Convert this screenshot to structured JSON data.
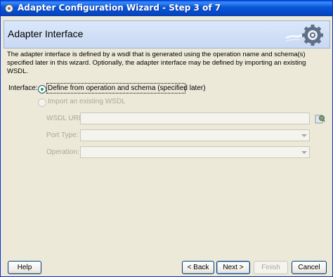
{
  "window": {
    "title": "Adapter Configuration Wizard - Step 3 of 7"
  },
  "header": {
    "title": "Adapter Interface"
  },
  "description": "The adapter interface is defined by a wsdl that is generated using the operation name and schema(s) specified later in this wizard.  Optionally, the adapter interface may be defined by importing an existing WSDL.",
  "interface": {
    "label": "Interface:",
    "option_define": "Define from operation and schema (specified later)",
    "option_import": "Import an existing WSDL",
    "selected": "define"
  },
  "fields": {
    "wsdl_url_label": "WSDL URL:",
    "wsdl_url_value": "",
    "port_type_label": "Port Type:",
    "port_type_value": "",
    "operation_label": "Operation:",
    "operation_value": ""
  },
  "buttons": {
    "help": "Help",
    "back": "< Back",
    "next": "Next >",
    "finish": "Finish",
    "cancel": "Cancel"
  },
  "colors": {
    "titlebar": "#0b57d9",
    "header_bg": "#c9d9f3",
    "dialog_bg": "#ece9d8",
    "disabled_text": "#aca899"
  },
  "icons": {
    "app": "wizard-app-icon",
    "header": "gear-connector-icon",
    "browse": "browse-wsdl-icon"
  }
}
